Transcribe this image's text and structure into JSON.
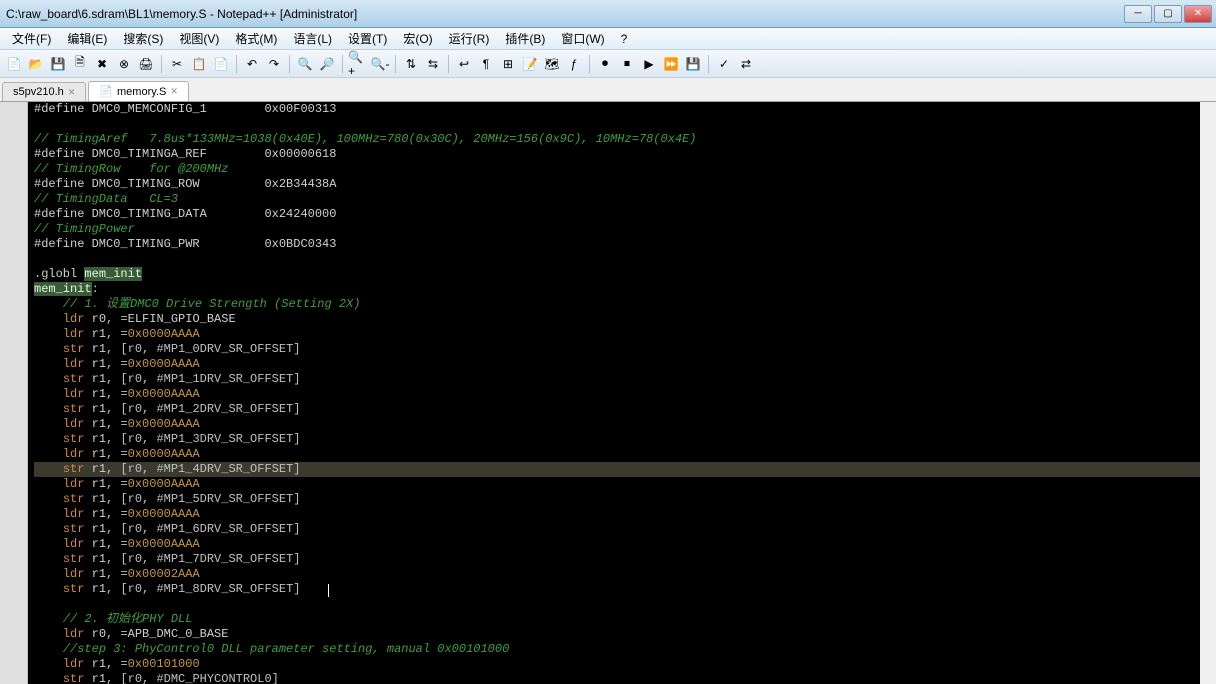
{
  "titlebar": {
    "path": "C:\\raw_board\\6.sdram\\BL1\\memory.S - Notepad++  [Administrator]"
  },
  "menu": {
    "file": "文件(F)",
    "edit": "编辑(E)",
    "search": "搜索(S)",
    "view": "视图(V)",
    "format": "格式(M)",
    "lang": "语言(L)",
    "settings": "设置(T)",
    "macro": "宏(O)",
    "run": "运行(R)",
    "plugins": "插件(B)",
    "window": "窗口(W)",
    "help": "?"
  },
  "tabs": {
    "t0": "s5pv210.h",
    "t1": "memory.S"
  },
  "code": {
    "lines": [
      {
        "t": "def",
        "a": "#define DMC0_MEMCONFIG_1",
        "b": "0x00F00313"
      },
      {
        "t": "blank"
      },
      {
        "t": "comment",
        "txt": "// TimingAref   7.8us*133MHz=1038(0x40E), 100MHz=780(0x30C), 20MHz=156(0x9C), 10MHz=78(0x4E)"
      },
      {
        "t": "def",
        "a": "#define DMC0_TIMINGA_REF",
        "b": "0x00000618"
      },
      {
        "t": "comment",
        "txt": "// TimingRow    for @200MHz"
      },
      {
        "t": "def",
        "a": "#define DMC0_TIMING_ROW",
        "b": "0x2B34438A"
      },
      {
        "t": "comment",
        "txt": "// TimingData   CL=3"
      },
      {
        "t": "def",
        "a": "#define DMC0_TIMING_DATA",
        "b": "0x24240000"
      },
      {
        "t": "comment",
        "txt": "// TimingPower"
      },
      {
        "t": "def",
        "a": "#define DMC0_TIMING_PWR",
        "b": "0x0BDC0343"
      },
      {
        "t": "blank"
      },
      {
        "t": "globl",
        "a": ".globl ",
        "b": "mem_init"
      },
      {
        "t": "label",
        "a": "mem_init",
        "b": ":"
      },
      {
        "t": "comment2",
        "txt": "// 1. 设置DMC0 Drive Strength (Setting 2X)"
      },
      {
        "t": "ldr",
        "r": "r0",
        "v": "=ELFIN_GPIO_BASE"
      },
      {
        "t": "ldr",
        "r": "r1",
        "v": "=0x0000AAAA"
      },
      {
        "t": "str",
        "r": "r1",
        "v": "[r0, #MP1_0DRV_SR_OFFSET]"
      },
      {
        "t": "ldr",
        "r": "r1",
        "v": "=0x0000AAAA"
      },
      {
        "t": "str",
        "r": "r1",
        "v": "[r0, #MP1_1DRV_SR_OFFSET]"
      },
      {
        "t": "ldr",
        "r": "r1",
        "v": "=0x0000AAAA"
      },
      {
        "t": "str",
        "r": "r1",
        "v": "[r0, #MP1_2DRV_SR_OFFSET]"
      },
      {
        "t": "ldr",
        "r": "r1",
        "v": "=0x0000AAAA"
      },
      {
        "t": "str",
        "r": "r1",
        "v": "[r0, #MP1_3DRV_SR_OFFSET]"
      },
      {
        "t": "ldr",
        "r": "r1",
        "v": "=0x0000AAAA"
      },
      {
        "t": "str",
        "r": "r1",
        "v": "[r0, #MP1_4DRV_SR_OFFSET]"
      },
      {
        "t": "ldr",
        "r": "r1",
        "v": "=0x0000AAAA"
      },
      {
        "t": "str",
        "r": "r1",
        "v": "[r0, #MP1_5DRV_SR_OFFSET]"
      },
      {
        "t": "ldr",
        "r": "r1",
        "v": "=0x0000AAAA"
      },
      {
        "t": "str",
        "r": "r1",
        "v": "[r0, #MP1_6DRV_SR_OFFSET]"
      },
      {
        "t": "ldr",
        "r": "r1",
        "v": "=0x0000AAAA"
      },
      {
        "t": "str",
        "r": "r1",
        "v": "[r0, #MP1_7DRV_SR_OFFSET]"
      },
      {
        "t": "ldr",
        "r": "r1",
        "v": "=0x00002AAA"
      },
      {
        "t": "str",
        "r": "r1",
        "v": "[r0, #MP1_8DRV_SR_OFFSET]"
      },
      {
        "t": "blank"
      },
      {
        "t": "comment2",
        "txt": "// 2. 初始化PHY DLL"
      },
      {
        "t": "ldr",
        "r": "r0",
        "v": "=APB_DMC_0_BASE"
      },
      {
        "t": "comment2",
        "txt": "//step 3: PhyControl0 DLL parameter setting, manual 0x00101000"
      },
      {
        "t": "ldr",
        "r": "r1",
        "v": "=0x00101000"
      },
      {
        "t": "str",
        "r": "r1",
        "v": "[r0, #DMC_PHYCONTROL0]"
      }
    ],
    "highlight_word": "mem_init",
    "current_line_index": 12
  }
}
